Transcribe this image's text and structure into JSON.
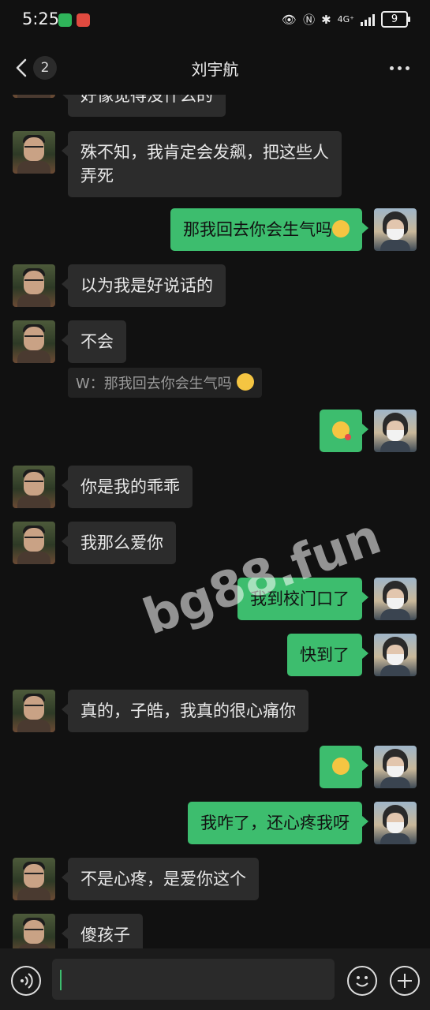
{
  "status": {
    "time": "5:25",
    "network": "4G⁺",
    "battery": "9"
  },
  "header": {
    "unread_count": "2",
    "title": "刘宇航"
  },
  "messages": [
    {
      "from": "him",
      "text": "好像觉得没什么的"
    },
    {
      "from": "him",
      "text": "殊不知，我肯定会发飙，把这些人",
      "text2": "弄死"
    },
    {
      "from": "me",
      "text": "那我回去你会生气吗",
      "emoji": "smile"
    },
    {
      "from": "him",
      "text": "以为我是好说话的"
    },
    {
      "from": "him",
      "text": "不会",
      "quote": "W：那我回去你会生气吗"
    },
    {
      "from": "me",
      "emoji": "kiss"
    },
    {
      "from": "him",
      "text": "你是我的乖乖"
    },
    {
      "from": "him",
      "text": "我那么爱你"
    },
    {
      "from": "me",
      "text": "我到校门口了"
    },
    {
      "from": "me",
      "text": "快到了"
    },
    {
      "from": "him",
      "text": "真的，子皓，我真的很心痛你"
    },
    {
      "from": "me",
      "emoji": "smile"
    },
    {
      "from": "me",
      "text": "我咋了，还心疼我呀"
    },
    {
      "from": "him",
      "text": "不是心疼，是爱你这个"
    },
    {
      "from": "him",
      "text": "傻孩子"
    }
  ],
  "watermark": "bg88.fun",
  "colors": {
    "background": "#111111",
    "incoming": "#2c2c2c",
    "outgoing": "#3dbd6e"
  }
}
